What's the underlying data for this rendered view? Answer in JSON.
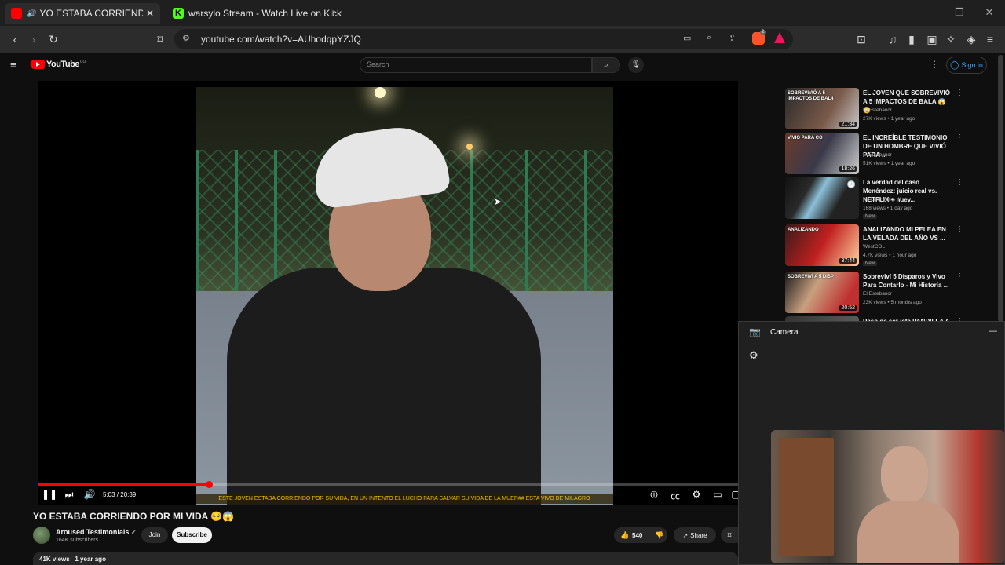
{
  "browser": {
    "tabs": [
      {
        "label": "YO ESTABA CORRIENDO POR",
        "active": true
      },
      {
        "label": "warsylo Stream - Watch Live on Kick",
        "active": false
      }
    ],
    "url": "youtube.com/watch?v=AUhodqpYZJQ",
    "shields_badge": "2"
  },
  "youtube": {
    "logo_text": "YouTube",
    "logo_region": "CO",
    "search_placeholder": "Search",
    "sign_in": "Sign in"
  },
  "player": {
    "subtitle": "ESTE JOVEN ESTABA CORRIENDO POR SU VIDA, EN UN INTENTO EL LUCHO PARA SALVAR SU VIDA DE LA MUER## ESTA VIVO DE MILAGRO",
    "time": "5:03 / 20:39",
    "progress_fraction": 0.2446
  },
  "video": {
    "title": "YO ESTABA CORRIENDO POR MI VIDA 😔😱",
    "channel": "Aroused Testimonials",
    "subscribers": "164K subscribers",
    "join": "Join",
    "subscribe": "Subscribe",
    "likes": "540",
    "share": "Share",
    "views": "41K views",
    "age": "1 year ago"
  },
  "recommendations": [
    {
      "title": "EL JOVEN QUE SOBREVIVIÓ A 5 IMPACTOS DE BALA 😱😳",
      "channel": "El Estebancr",
      "meta": "27K views • 1 year ago",
      "duration": "21:34",
      "thumb_text": "SOBREVIVIÓ A 5 IMPACTOS DE BAL4",
      "new": ""
    },
    {
      "title": "EL INCREÍBLE TESTIMONIO DE UN HOMBRE QUE VIVIÓ PARA ...",
      "channel": "El Estebancr",
      "meta": "51K views • 1 year ago",
      "duration": "18:26",
      "thumb_text": "VIVIO PARA CO",
      "new": ""
    },
    {
      "title": "La verdad del caso Menéndez: juicio real vs. NETFLIX + nuev...",
      "channel": "No Limit Wero !!!",
      "meta": "168 views • 1 day ago",
      "duration": "",
      "thumb_text": "",
      "new": "New"
    },
    {
      "title": "ANALIZANDO MI PELEA EN LA VELADA DEL AÑO VS ...",
      "channel": "WestCOL",
      "meta": "4.7K views • 1 hour ago",
      "duration": "37:44",
      "thumb_text": "ANALIZANDO",
      "new": "New"
    },
    {
      "title": "Sobreviví 5 Disparos y Vivo Para Contarlo - Mi Historia ...",
      "channel": "El Estebancr",
      "meta": "23K views • 5 months ago",
      "duration": "20:52",
      "thumb_text": "SOBREVIVÍ A 5 DISP",
      "new": ""
    },
    {
      "title": "Paso de ser jefa PANDILLA A ...",
      "channel": "",
      "meta": "",
      "duration": "",
      "thumb_text": "",
      "new": ""
    }
  ],
  "camera": {
    "title": "Camera"
  },
  "colors": {
    "youtube_red": "#ff0000",
    "link_blue": "#3ea6ff",
    "subtitle_yellow": "#f0c000"
  }
}
